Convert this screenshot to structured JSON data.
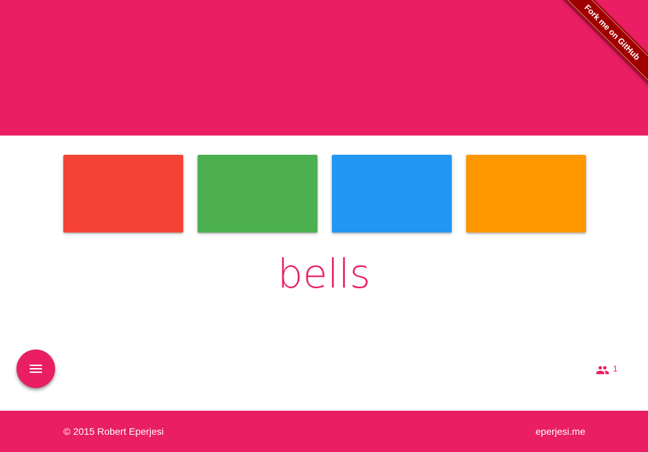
{
  "header": {
    "color": "#e91e63",
    "ribbon_label": "Fork me on GitHub",
    "ribbon_color": "#a00000"
  },
  "tiles": [
    {
      "color": "#f44336"
    },
    {
      "color": "#4caf50"
    },
    {
      "color": "#2196f3"
    },
    {
      "color": "#ff9800"
    }
  ],
  "main": {
    "word": "bells"
  },
  "fab": {
    "icon": "menu-icon"
  },
  "users": {
    "icon": "people-icon",
    "count": "1"
  },
  "footer": {
    "copyright": "© 2015 Robert Eperjesi",
    "link_label": "eperjesi.me"
  }
}
